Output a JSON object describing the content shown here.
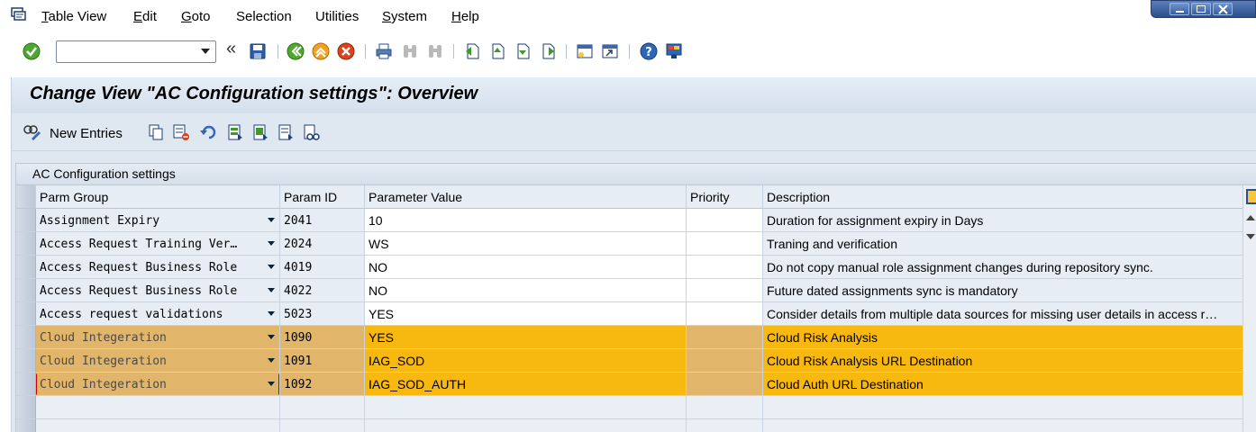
{
  "menu": {
    "items": [
      {
        "label": "Table View",
        "ul": "T",
        "rest": "able View"
      },
      {
        "label": "Edit",
        "ul": "E",
        "rest": "dit"
      },
      {
        "label": "Goto",
        "ul": "G",
        "rest": "oto"
      },
      {
        "label": "Selection",
        "ul": "",
        "rest": "Selection"
      },
      {
        "label": "Utilities",
        "ul": "",
        "rest": "Utilities"
      },
      {
        "label": "System",
        "ul": "S",
        "rest": "ystem"
      },
      {
        "label": "Help",
        "ul": "H",
        "rest": "elp"
      }
    ]
  },
  "toolbar": {
    "command_value": "",
    "collapse_glyph": "«",
    "icons": [
      "enter-icon",
      "save-icon",
      "back-icon",
      "exit-icon",
      "cancel-icon",
      "print-icon",
      "find-icon",
      "find-next-icon",
      "first-page-icon",
      "previous-page-icon",
      "next-page-icon",
      "last-page-icon",
      "create-session-icon",
      "shortcut-icon",
      "help-icon",
      "layout-icon"
    ]
  },
  "page": {
    "title": "Change View \"AC Configuration settings\": Overview"
  },
  "app_toolbar": {
    "new_entries_label": "New Entries",
    "icons": [
      "display-change-icon",
      "copy-icon",
      "delete-icon",
      "undo-icon",
      "select-all-icon",
      "select-block-icon",
      "deselect-all-icon",
      "glasses-icon"
    ]
  },
  "table": {
    "caption": "AC Configuration settings",
    "columns": [
      "Parm Group",
      "Param ID",
      "Parameter Value",
      "Priority",
      "Description"
    ],
    "rows": [
      {
        "parm_group": "Assignment Expiry",
        "param_id": "2041",
        "value": "10",
        "priority": "",
        "description": "Duration for assignment expiry in Days",
        "highlight": false
      },
      {
        "parm_group": "Access Request Training Ver…",
        "param_id": "2024",
        "value": "WS",
        "priority": "",
        "description": "Traning and verification",
        "highlight": false
      },
      {
        "parm_group": "Access Request Business Role",
        "param_id": "4019",
        "value": "NO",
        "priority": "",
        "description": "Do not copy manual role assignment changes during repository sync.",
        "highlight": false
      },
      {
        "parm_group": "Access Request Business Role",
        "param_id": "4022",
        "value": "NO",
        "priority": "",
        "description": "Future dated assignments sync is mandatory",
        "highlight": false
      },
      {
        "parm_group": "Access request validations",
        "param_id": "5023",
        "value": "YES",
        "priority": "",
        "description": "Consider details from multiple data sources for missing user details in access r…",
        "highlight": false
      },
      {
        "parm_group": "Cloud Integeration",
        "param_id": "1090",
        "value": "YES",
        "priority": "",
        "description": "Cloud Risk Analysis",
        "highlight": true
      },
      {
        "parm_group": "Cloud Integeration",
        "param_id": "1091",
        "value": "IAG_SOD",
        "priority": "",
        "description": "Cloud Risk Analysis URL Destination",
        "highlight": true
      },
      {
        "parm_group": "Cloud Integeration",
        "param_id": "1092",
        "value": "IAG_SOD_AUTH",
        "priority": "",
        "description": "Cloud Auth URL Destination",
        "highlight": true
      }
    ]
  },
  "colors": {
    "highlight_value": "#f7b810",
    "highlight_group": "#e2b66a",
    "frame_bg": "#dfe8f1"
  }
}
